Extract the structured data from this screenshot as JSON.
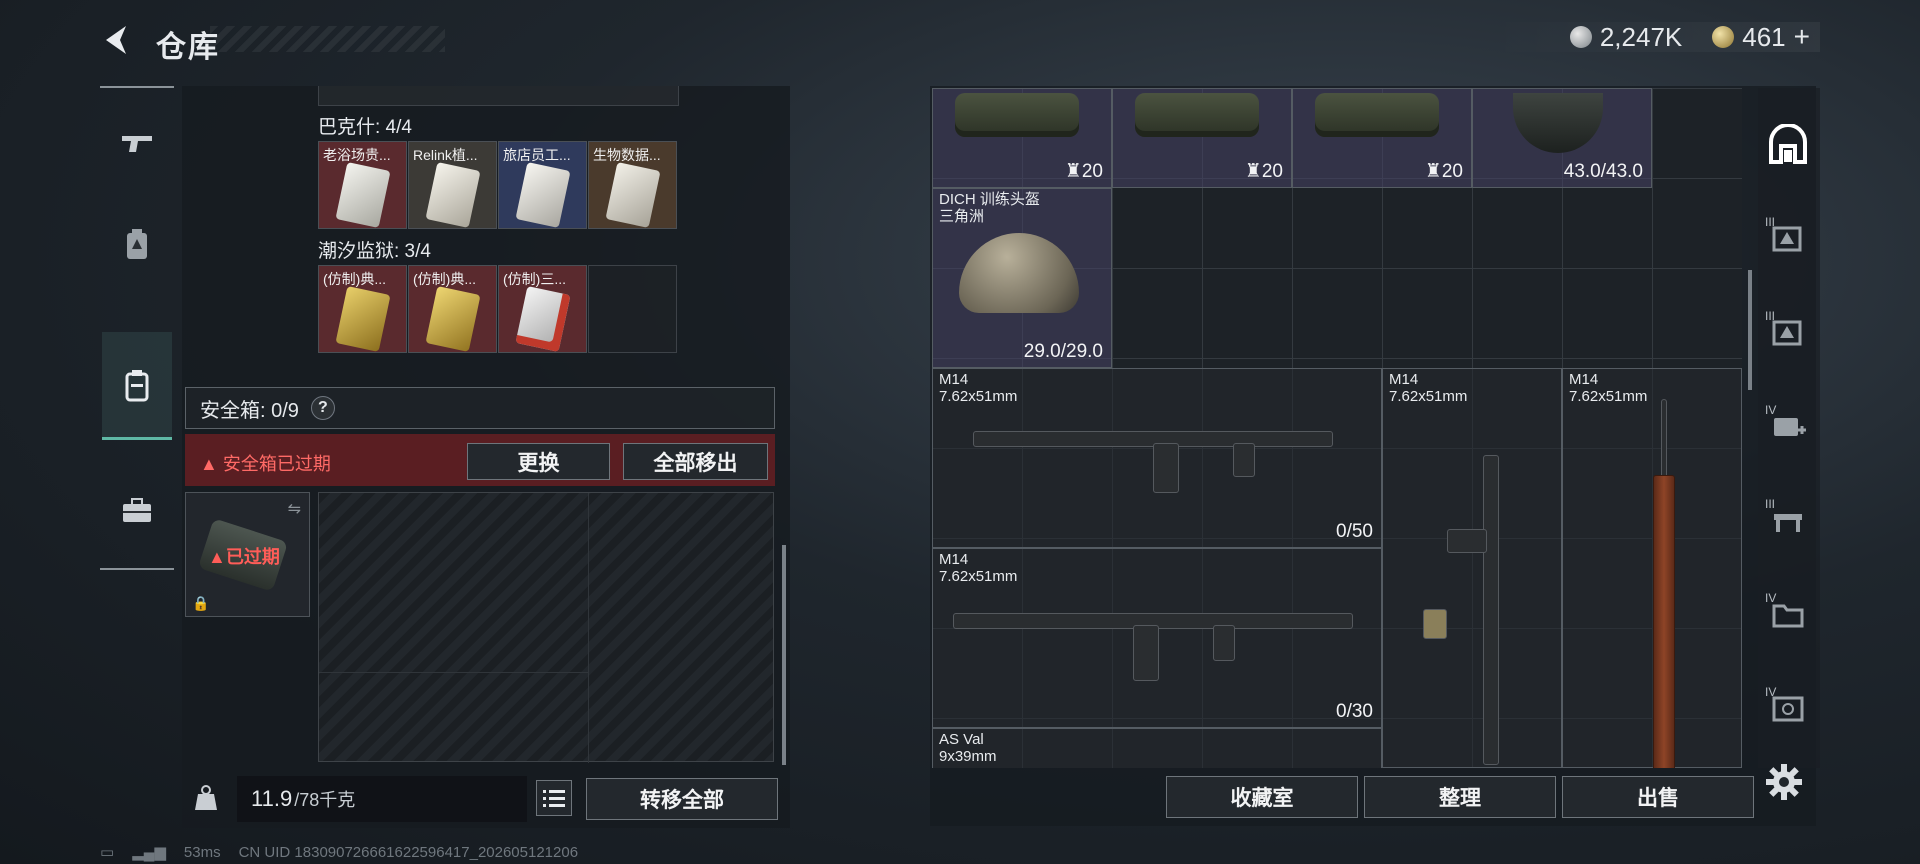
{
  "header": {
    "title": "仓库",
    "currency": [
      {
        "icon": "silver-coin-icon",
        "value": "2,247K"
      },
      {
        "icon": "gold-coin-icon",
        "value": "461"
      }
    ],
    "add_label": "+"
  },
  "left_nav": {
    "items": [
      {
        "icon": "weapon-icon"
      },
      {
        "icon": "backpack-tier-icon"
      },
      {
        "icon": "backpack-icon",
        "active": true
      },
      {
        "icon": "toolbox-icon"
      }
    ]
  },
  "collections": [
    {
      "label": "巴克什: 4/4",
      "slots": [
        {
          "name": "老浴场贵...",
          "tint": "#5a2a2e",
          "card": "#d7d7d0"
        },
        {
          "name": "Relink植...",
          "tint": "#3c3a36",
          "card": "#e3e0d7"
        },
        {
          "name": "旅店员工...",
          "tint": "#2f3a5c",
          "card": "#e6e4de"
        },
        {
          "name": "生物数据...",
          "tint": "#4a3a2c",
          "card": "#e0ddd4"
        }
      ]
    },
    {
      "label": "潮汐监狱: 3/4",
      "slots": [
        {
          "name": "(仿制)典...",
          "tint": "#5a2a2e",
          "card": "#c8a84a"
        },
        {
          "name": "(仿制)典...",
          "tint": "#5a2a2e",
          "card": "#d0b24c"
        },
        {
          "name": "(仿制)三...",
          "tint": "#5a2a2e",
          "card": "#e4e4e4"
        }
      ]
    }
  ],
  "safe_box": {
    "label": "安全箱: 0/9",
    "help": "?",
    "expired_text": "安全箱已过期",
    "replace_label": "更换",
    "remove_all_label": "全部移出",
    "case_status": "已过期"
  },
  "weight": {
    "value": "11.9",
    "unit": "/78千克"
  },
  "transfer_all_label": "转移全部",
  "stash": {
    "bags": [
      {
        "value": "20"
      },
      {
        "value": "20"
      },
      {
        "value": "20"
      }
    ],
    "helmet_top": {
      "value": "43.0/43.0"
    },
    "helmet": {
      "name": "DICH 训练头盔",
      "origin": "三角洲",
      "value": "29.0/29.0"
    },
    "guns": [
      {
        "name": "M14",
        "ammo": "7.62x51mm",
        "value": "0/50"
      },
      {
        "name": "M14",
        "ammo": "7.62x51mm",
        "value": "0/30"
      },
      {
        "name": "M14",
        "ammo": "7.62x51mm",
        "value": ""
      },
      {
        "name": "M14",
        "ammo": "7.62x51mm",
        "value": ""
      },
      {
        "name": "AS Val",
        "ammo": "9x39mm",
        "value": ""
      }
    ]
  },
  "right_tabs": [
    {
      "icon": "stash-home-icon",
      "roman": ""
    },
    {
      "icon": "tier-3-storage-icon",
      "roman": "III"
    },
    {
      "icon": "tier-3-storage-icon",
      "roman": "III"
    },
    {
      "icon": "tier-4-medical-icon",
      "roman": "IV"
    },
    {
      "icon": "tier-3-workbench-icon",
      "roman": "III"
    },
    {
      "icon": "tier-4-folder-icon",
      "roman": "IV"
    },
    {
      "icon": "tier-4-safe-icon",
      "roman": "IV"
    }
  ],
  "bottom_actions": {
    "collection_label": "收藏室",
    "organize_label": "整理",
    "sell_label": "出售"
  },
  "footer": {
    "ping": "53ms",
    "uid": "CN UID 183090726661622596417_202605121206"
  }
}
